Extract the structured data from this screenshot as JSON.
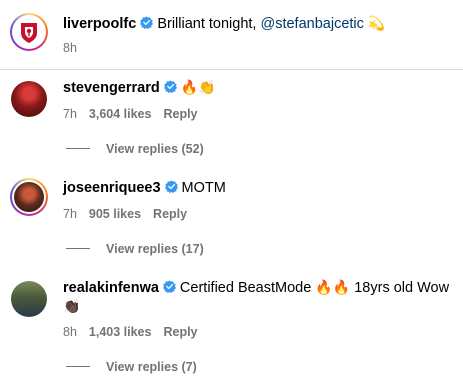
{
  "caption": {
    "username": "liverpoolfc",
    "text": "Brilliant tonight,",
    "mention": "@stefanbajcetic",
    "emoji": "💫",
    "time": "8h"
  },
  "comments": [
    {
      "username": "stevengerrard",
      "text": "",
      "emoji": "🔥👏",
      "time": "7h",
      "likes": "3,604 likes",
      "reply": "Reply",
      "view_replies": "View replies (52)"
    },
    {
      "username": "joseenriquee3",
      "text": "MOTM",
      "emoji": "",
      "time": "7h",
      "likes": "905 likes",
      "reply": "Reply",
      "view_replies": "View replies (17)"
    },
    {
      "username": "realakinfenwa",
      "text": "Certified BeastMode",
      "emoji": "🔥🔥",
      "text2": "18yrs old Wow",
      "emoji2": "👏🏿",
      "time": "8h",
      "likes": "1,403 likes",
      "reply": "Reply",
      "view_replies": "View replies (7)"
    }
  ],
  "colors": {
    "verified": "#3897f0",
    "liverpool_red": "#c8102e",
    "mention": "#00376b",
    "secondary_text": "#737373"
  }
}
